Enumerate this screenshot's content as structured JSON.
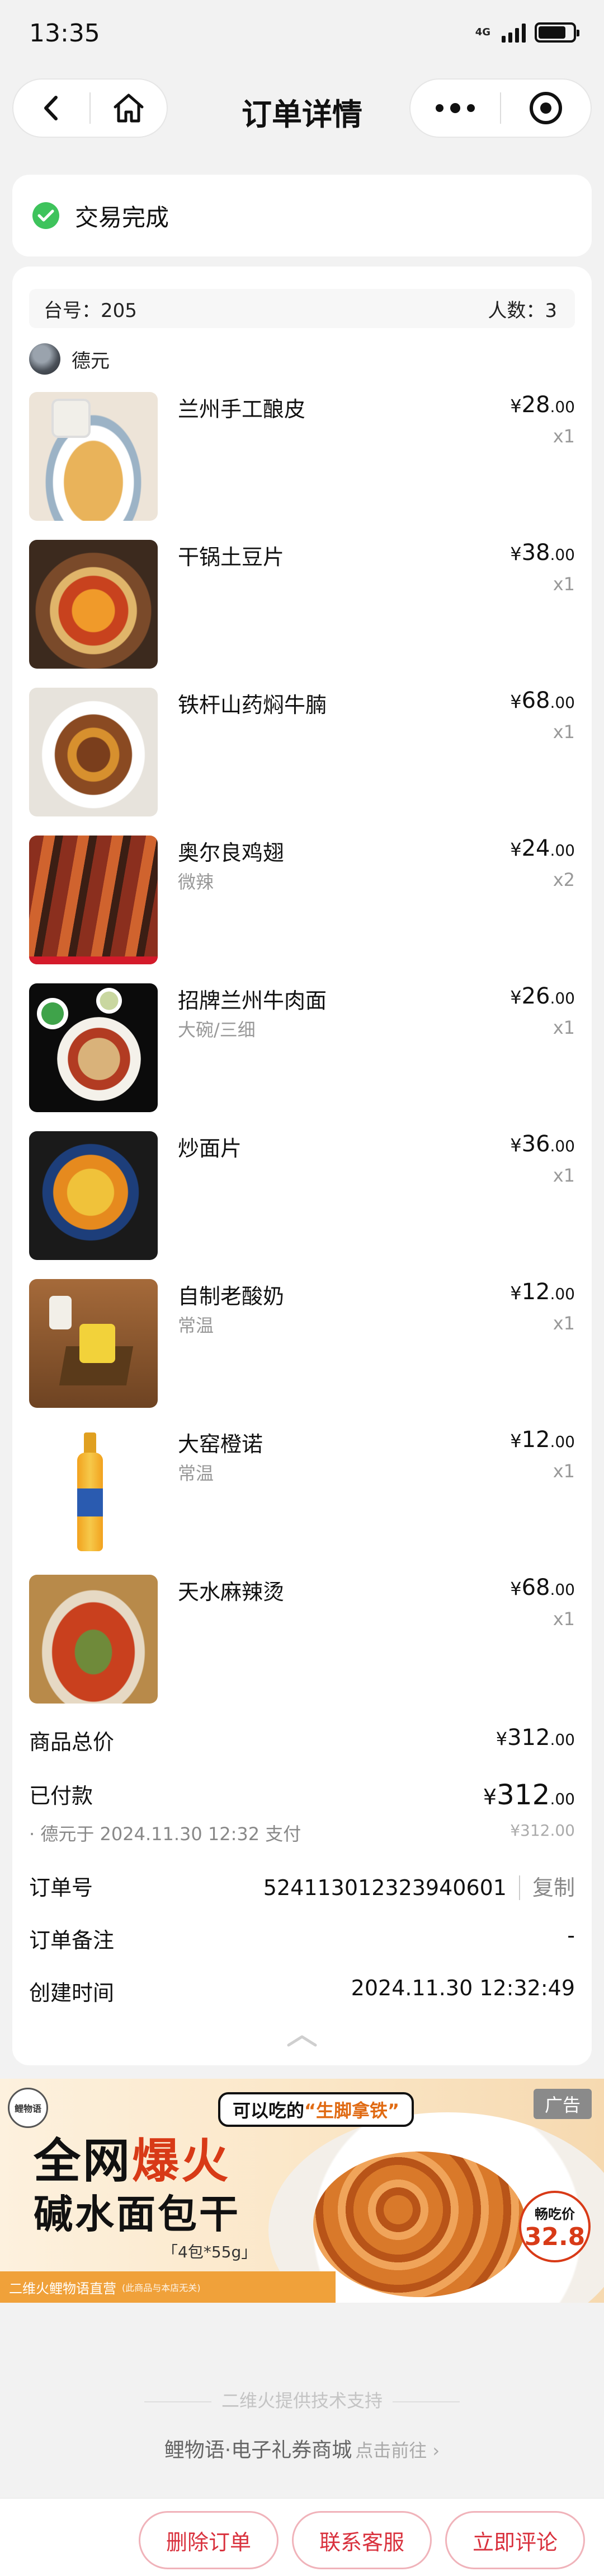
{
  "status_bar": {
    "time": "13:35",
    "network": "4G"
  },
  "nav": {
    "title": "订单详情"
  },
  "order_status": {
    "text": "交易完成"
  },
  "table": {
    "table_label": "台号：205",
    "people_label": "人数：3"
  },
  "user": {
    "name": "德元"
  },
  "items": [
    {
      "name": "兰州手工酿皮",
      "spec": "",
      "currency": "¥",
      "price_int": "28",
      "price_dec": ".00",
      "qty": "x1"
    },
    {
      "name": "干锅土豆片",
      "spec": "",
      "currency": "¥",
      "price_int": "38",
      "price_dec": ".00",
      "qty": "x1"
    },
    {
      "name": "铁杆山药焖牛腩",
      "spec": "",
      "currency": "¥",
      "price_int": "68",
      "price_dec": ".00",
      "qty": "x1"
    },
    {
      "name": "奥尔良鸡翅",
      "spec": "微辣",
      "currency": "¥",
      "price_int": "24",
      "price_dec": ".00",
      "qty": "x2"
    },
    {
      "name": "招牌兰州牛肉面",
      "spec": "大碗/三细",
      "currency": "¥",
      "price_int": "26",
      "price_dec": ".00",
      "qty": "x1"
    },
    {
      "name": "炒面片",
      "spec": "",
      "currency": "¥",
      "price_int": "36",
      "price_dec": ".00",
      "qty": "x1"
    },
    {
      "name": "自制老酸奶",
      "spec": "常温",
      "currency": "¥",
      "price_int": "12",
      "price_dec": ".00",
      "qty": "x1"
    },
    {
      "name": "大窑橙诺",
      "spec": "常温",
      "currency": "¥",
      "price_int": "12",
      "price_dec": ".00",
      "qty": "x1"
    },
    {
      "name": "天水麻辣烫",
      "spec": "",
      "currency": "¥",
      "price_int": "68",
      "price_dec": ".00",
      "qty": "x1"
    }
  ],
  "summary": {
    "total_label": "商品总价",
    "total_currency": "¥",
    "total_int": "312",
    "total_dec": ".00",
    "paid_label": "已付款",
    "paid_currency": "¥",
    "paid_int": "312",
    "paid_dec": ".00",
    "paid_note": "· 德元于 2024.11.30 12:32 支付",
    "paid_sub": "¥312.00",
    "order_no_label": "订单号",
    "order_no": "524113012323940601",
    "copy_label": "复制",
    "remark_label": "订单备注",
    "remark_value": "-",
    "created_label": "创建时间",
    "created_value": "2024.11.30 12:32:49"
  },
  "ad": {
    "tag": "广告",
    "logo": "鲤物语",
    "bubble_prefix": "可以吃的",
    "bubble_quote": "“生脚拿铁”",
    "line1_a": "全网",
    "line1_b": "爆火",
    "line2": "碱水面包干",
    "spec": "「4包*55g」",
    "strip": "二维火鲤物语直营",
    "strip_small": "(此商品与本店无关)",
    "badge_title": "畅吃价",
    "badge_price": "32.8"
  },
  "footer": {
    "powered": "二维火提供技术支持",
    "link_text": "鲤物语·电子礼券商城",
    "link_hint": "点击前往 ›"
  },
  "actions": {
    "delete": "删除订单",
    "service": "联系客服",
    "review": "立即评论"
  }
}
